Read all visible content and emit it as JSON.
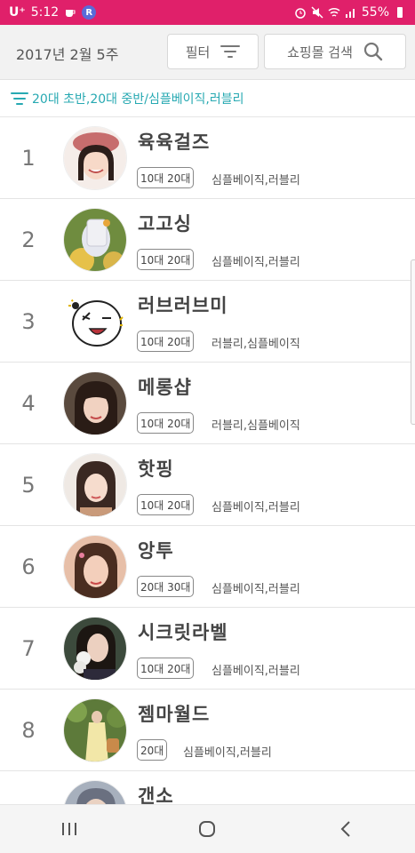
{
  "status_bar": {
    "carrier": "U⁺",
    "time": "5:12",
    "r_badge": "R",
    "battery": "55%"
  },
  "header": {
    "week": "2017년 2월 5주",
    "filter_label": "필터",
    "search_label": "쇼핑몰 검색"
  },
  "filter_tags": "20대 초반,20대 중반/심플베이직,러블리",
  "accent_color": "#27a9b2",
  "status_color": "#e0206a",
  "shops": [
    {
      "rank": "1",
      "name": "육육걸즈",
      "age": "10대 20대",
      "style": "심플베이직,러블리"
    },
    {
      "rank": "2",
      "name": "고고싱",
      "age": "10대 20대",
      "style": "심플베이직,러블리"
    },
    {
      "rank": "3",
      "name": "러브러브미",
      "age": "10대 20대",
      "style": "러블리,심플베이직"
    },
    {
      "rank": "4",
      "name": "메롱샵",
      "age": "10대 20대",
      "style": "러블리,심플베이직"
    },
    {
      "rank": "5",
      "name": "핫핑",
      "age": "10대 20대",
      "style": "심플베이직,러블리"
    },
    {
      "rank": "6",
      "name": "앙투",
      "age": "20대 30대",
      "style": "심플베이직,러블리"
    },
    {
      "rank": "7",
      "name": "시크릿라벨",
      "age": "10대 20대",
      "style": "심플베이직,러블리"
    },
    {
      "rank": "8",
      "name": "젬마월드",
      "age": "20대",
      "style": "심플베이직,러블리"
    },
    {
      "rank": "",
      "name": "갠소",
      "age": "",
      "style": ""
    }
  ],
  "icons": {
    "filter": "filter-lines-icon",
    "search": "magnifier-icon",
    "recent": "recents-icon",
    "home": "home-icon",
    "back": "back-chevron-icon"
  }
}
